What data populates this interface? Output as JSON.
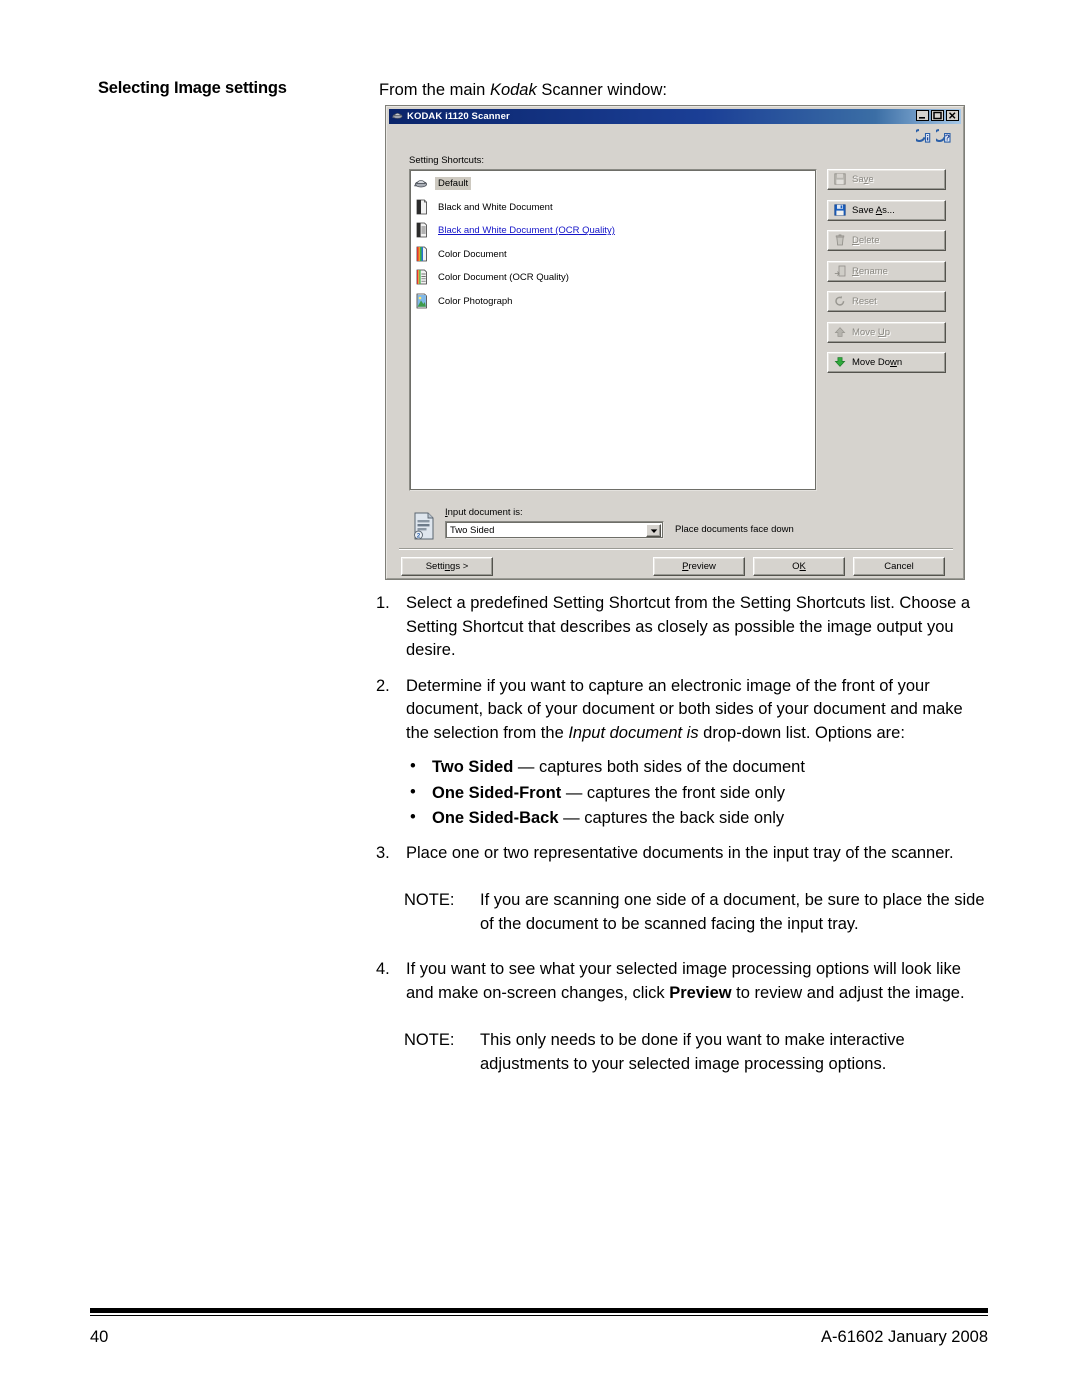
{
  "page": {
    "section_title": "Selecting Image settings",
    "intro_prefix": "From the main ",
    "intro_italic": "Kodak",
    "intro_suffix": " Scanner window:",
    "footer_page_number": "40",
    "footer_doc_id": "A-61602  January 2008"
  },
  "dialog": {
    "title": "KODAK i1120 Scanner",
    "window_buttons": [
      "minimize",
      "maximize",
      "close"
    ],
    "help_icons": [
      "info-help-icon",
      "question-help-icon"
    ],
    "shortcuts_label": "Setting Shortcuts:",
    "shortcuts": [
      {
        "label": "Default",
        "icon": "scanner-icon",
        "selected": true,
        "link": false
      },
      {
        "label": "Black and White Document",
        "icon": "bw-document-icon",
        "selected": false,
        "link": false
      },
      {
        "label": "Black and White Document (OCR Quality)",
        "icon": "bw-document-ocr-icon",
        "selected": false,
        "link": true
      },
      {
        "label": "Color Document",
        "icon": "color-document-icon",
        "selected": false,
        "link": false
      },
      {
        "label": "Color Document (OCR Quality)",
        "icon": "color-document-ocr-icon",
        "selected": false,
        "link": false
      },
      {
        "label": "Color Photograph",
        "icon": "color-photograph-icon",
        "selected": false,
        "link": false
      }
    ],
    "side_buttons": [
      {
        "label": "Save",
        "accel": "v",
        "icon": "floppy-disk-icon",
        "enabled": false
      },
      {
        "label": "Save As...",
        "accel": "A",
        "icon": "floppy-disk-icon",
        "enabled": true
      },
      {
        "label": "Delete",
        "accel": "D",
        "icon": "trash-can-icon",
        "enabled": false
      },
      {
        "label": "Rename",
        "accel": "R",
        "icon": "rename-icon",
        "enabled": false
      },
      {
        "label": "Reset",
        "accel": "",
        "icon": "reset-arrow-icon",
        "enabled": false
      },
      {
        "label": "Move Up",
        "accel": "U",
        "icon": "arrow-up-icon",
        "enabled": false
      },
      {
        "label": "Move Down",
        "accel": "w",
        "icon": "arrow-down-icon",
        "enabled": true
      }
    ],
    "input_document": {
      "icon": "two-sided-document-icon",
      "label": "Input document is:",
      "label_accel": "I",
      "value": "Two Sided",
      "options": [
        "Two Sided",
        "One Sided-Front",
        "One Sided-Back"
      ],
      "hint": "Place documents face down"
    },
    "bottom_buttons": [
      {
        "name": "settings",
        "label": "Settings >",
        "accel": "n"
      },
      {
        "name": "preview",
        "label": "Preview",
        "accel": "P"
      },
      {
        "name": "ok",
        "label": "OK",
        "accel": "K"
      },
      {
        "name": "cancel",
        "label": "Cancel",
        "accel": ""
      }
    ],
    "colors": {
      "titlebar_start": "#0a246a",
      "titlebar_end": "#a6c8e8",
      "dialog_face": "#d6d3ce",
      "link_text": "#1414c8",
      "selection": "#cdc9c0"
    }
  },
  "instructions": {
    "steps": [
      {
        "num": "1.",
        "html": "Select a predefined Setting Shortcut from the Setting Shortcuts list. Choose a Setting Shortcut that describes as closely as possible the image output you desire."
      },
      {
        "num": "2.",
        "html": "Determine if you want to capture an electronic image of the front of your document, back of your document or both sides of your document and make the selection from the <i>Input document is</i> drop-down list. Options are:"
      }
    ],
    "bullets": [
      {
        "dot": "•",
        "bold": "Two Sided",
        "rest": " — captures both sides of the document"
      },
      {
        "dot": "•",
        "bold": "One Sided-Front",
        "rest": " — captures the front side only"
      },
      {
        "dot": "•",
        "bold": "One Sided-Back",
        "rest": " — captures the back side only"
      }
    ],
    "step3": {
      "num": "3.",
      "html": "Place one or two representative documents in the input tray of the scanner."
    },
    "note1": {
      "label": "NOTE:",
      "html": "If you are scanning one side of a document, be sure to place the side of the document to be scanned facing the input tray."
    },
    "step4": {
      "num": "4.",
      "html": "If you want to see what your selected image processing options will look like and make on-screen changes, click <b>Preview</b> to review and adjust the image."
    },
    "note2": {
      "label": "NOTE:",
      "html": "This only needs to be done if you want to make interactive adjustments to your selected image processing options."
    }
  }
}
